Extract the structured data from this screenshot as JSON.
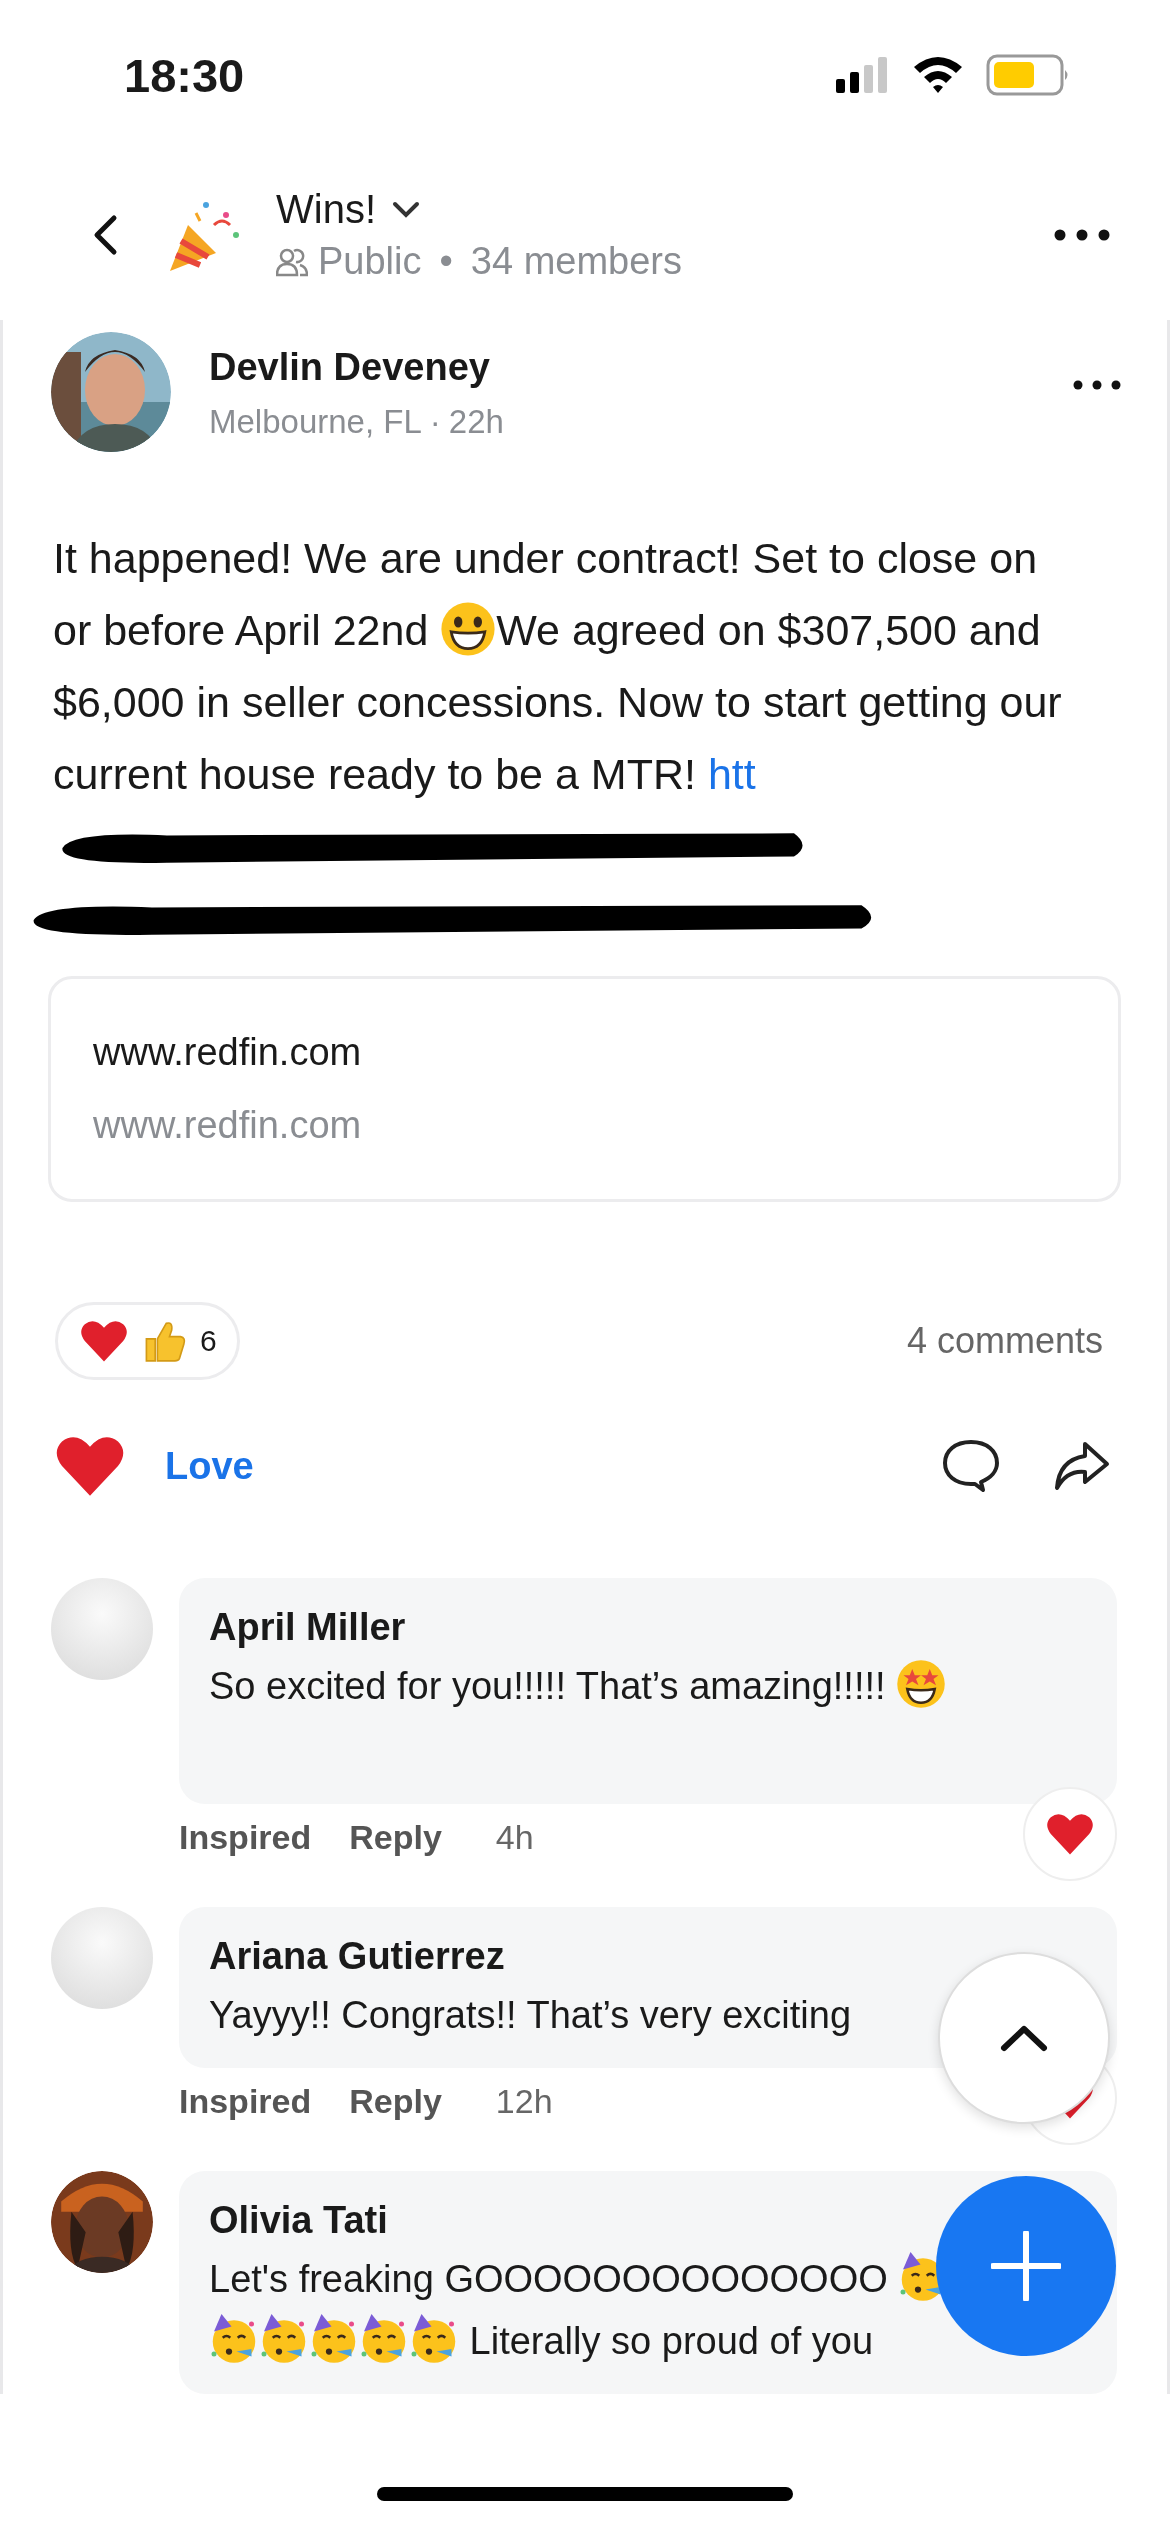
{
  "status_bar": {
    "time": "18:30"
  },
  "header": {
    "title": "Wins!",
    "visibility": "Public",
    "separator": "•",
    "members": "34 members"
  },
  "post": {
    "author": "Devlin Deveney",
    "avatar_photo": true,
    "location": "Melbourne, FL",
    "separator": "·",
    "time": "22h",
    "body": [
      {
        "kind": "text",
        "text": "It happened! We are under contract! Set to close on or before April 22nd "
      },
      {
        "kind": "grin"
      },
      {
        "kind": "text",
        "text": "We agreed on $307,500 and $6,000 in seller concessions. Now to start getting our current house ready to be a MTR! "
      },
      {
        "kind": "link",
        "text": "htt"
      },
      {
        "kind": "redaction"
      },
      {
        "kind": "redaction"
      }
    ],
    "preview": {
      "title": "www.redfin.com",
      "url": "www.redfin.com"
    },
    "reaction_count": "6",
    "comments_count": "4 comments",
    "love": {
      "label": "Love",
      "selected": true
    }
  },
  "comments": [
    {
      "author": "April Miller",
      "avatar_photo": false,
      "parts": [
        {
          "kind": "text",
          "text": "So excited for you!!!!! That’s amazing!!!!! "
        },
        {
          "kind": "starstruck"
        }
      ],
      "reaction": "Inspired",
      "reply": "Reply",
      "time": "4h",
      "loved": true,
      "tall": true
    },
    {
      "author": "Ariana Gutierrez",
      "avatar_photo": false,
      "parts": [
        {
          "kind": "text",
          "text": "Yayyy!! Congrats!! That’s very exciting"
        }
      ],
      "reaction": "Inspired",
      "reply": "Reply",
      "time": "12h",
      "loved": true,
      "tall": false
    },
    {
      "author": "Olivia Tati",
      "avatar_photo": true,
      "parts": [
        {
          "kind": "text",
          "text": "Let's freaking GOOOOOOOOOOOOOO "
        },
        {
          "kind": "party"
        },
        {
          "kind": "party"
        },
        {
          "kind": "party"
        },
        {
          "kind": "party"
        },
        {
          "kind": "party"
        },
        {
          "kind": "party"
        },
        {
          "kind": "text",
          "text": " Literally so proud of you"
        }
      ],
      "loved": false,
      "tall": false
    }
  ]
}
